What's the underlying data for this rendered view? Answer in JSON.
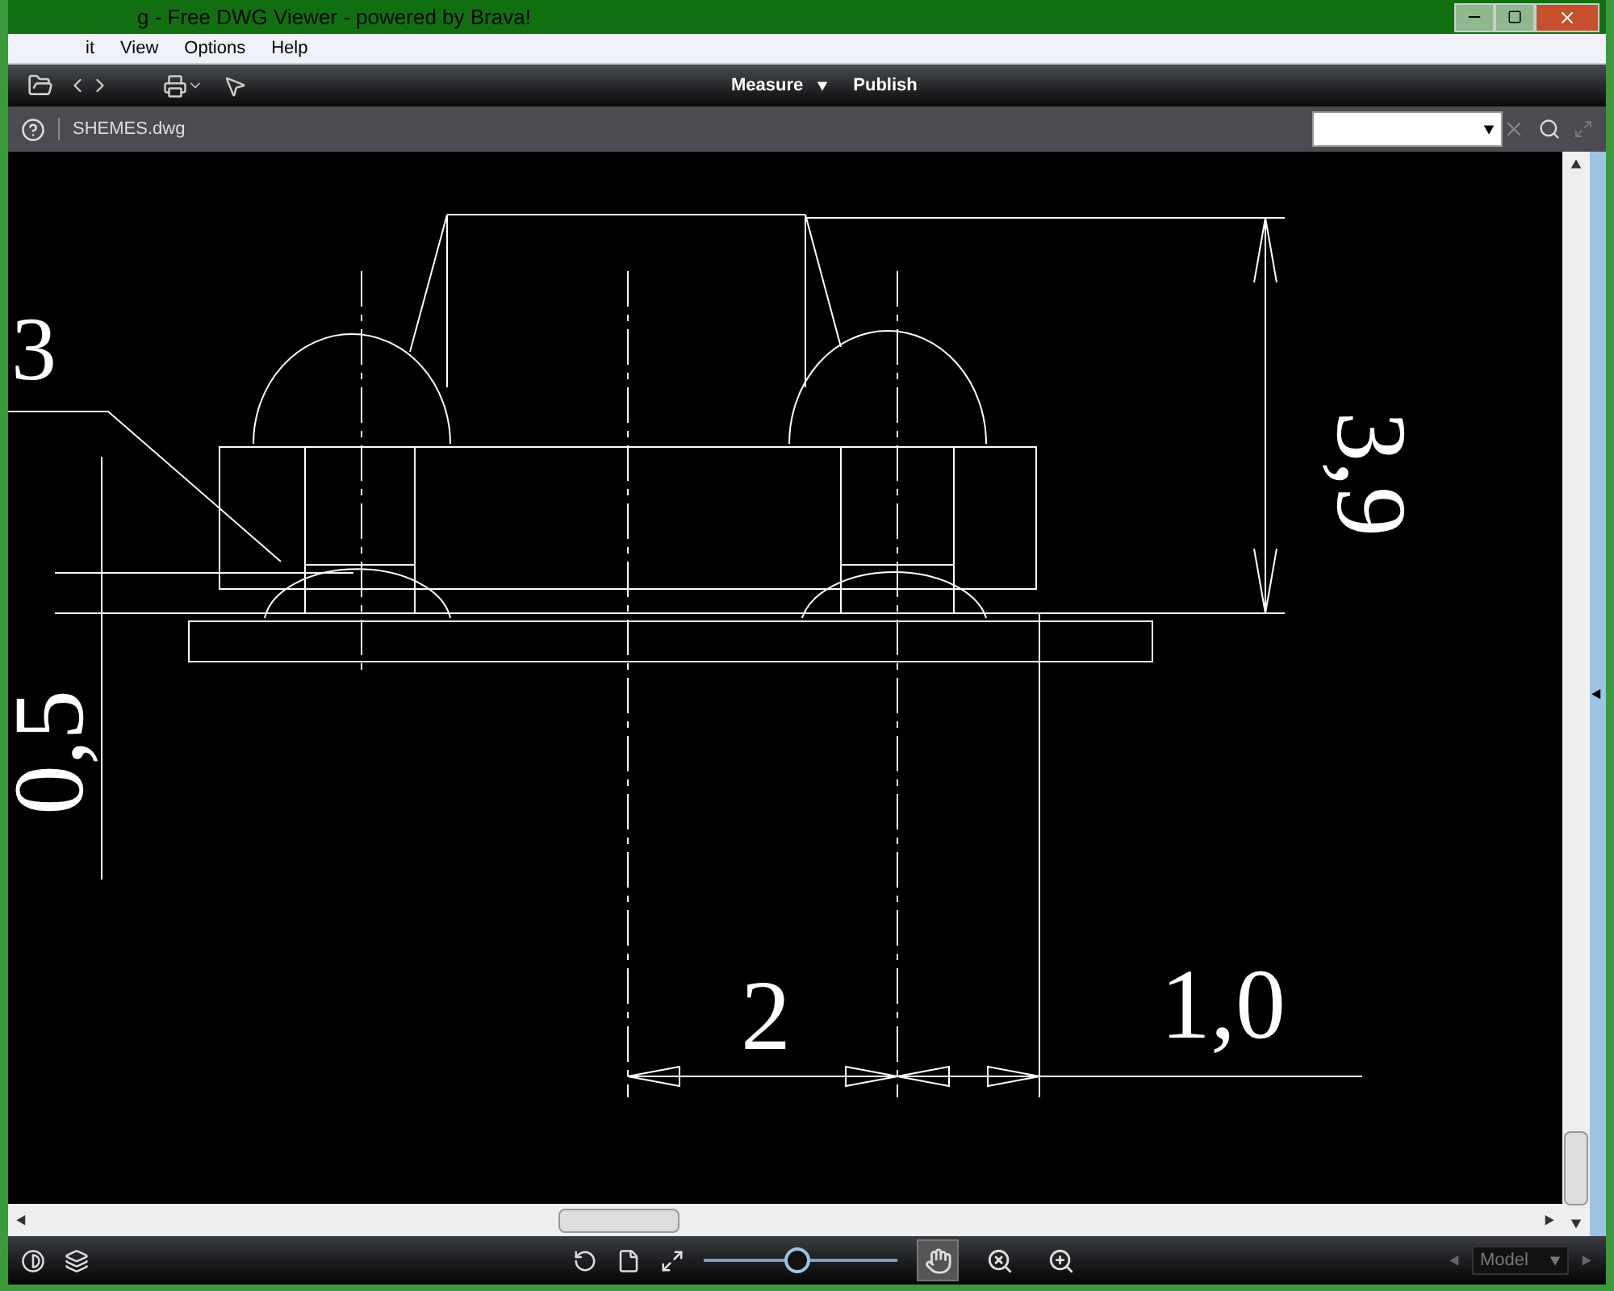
{
  "window": {
    "title": "g - Free DWG Viewer - powered by Brava!"
  },
  "menu": [
    {
      "label": "it"
    },
    {
      "label": "View"
    },
    {
      "label": "Options"
    },
    {
      "label": "Help"
    }
  ],
  "toolbar": {
    "menus": [
      {
        "label": "Measure",
        "dropdown": true
      },
      {
        "label": "Publish",
        "dropdown": false
      }
    ]
  },
  "file_bar": {
    "file_name": "SHEMES.dwg"
  },
  "drawing": {
    "labels": [
      {
        "text": "3",
        "kind": "plain"
      },
      {
        "text": "3,9",
        "kind": "down"
      },
      {
        "text": "0,5",
        "kind": "up"
      },
      {
        "text": "2",
        "kind": "plain"
      },
      {
        "text": "1,0",
        "kind": "plain"
      }
    ]
  },
  "bottom_bar": {
    "zoom": {
      "level": 0.48
    },
    "tools": [
      {
        "kind": "pan",
        "selected": true
      },
      {
        "kind": "zoom-window",
        "selected": false
      },
      {
        "kind": "zoom-extents",
        "selected": false
      }
    ],
    "layout": "Model"
  }
}
